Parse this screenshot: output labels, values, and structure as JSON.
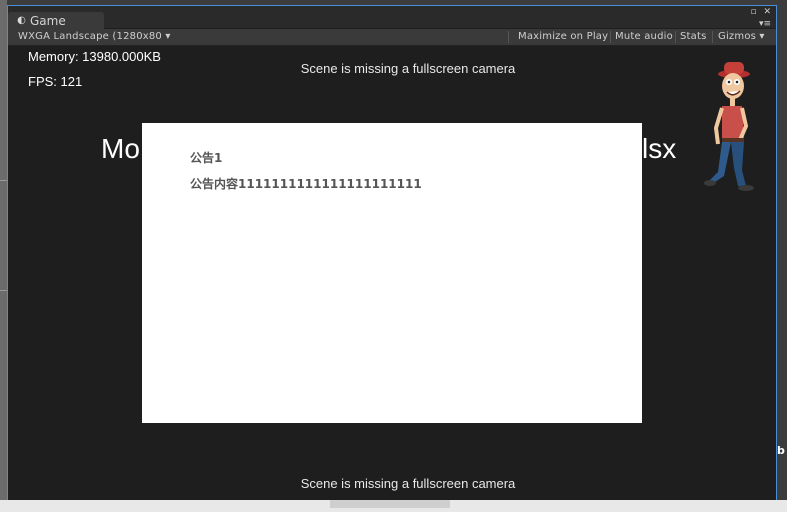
{
  "tab": {
    "label": "Game"
  },
  "window_controls": {
    "restore": "▫",
    "close": "✕",
    "menu": "▾≡"
  },
  "toolbar": {
    "resolution": "WXGA Landscape (1280x80 ▾",
    "maximize_on_play": "Maximize on Play",
    "mute_audio": "Mute audio",
    "stats": "Stats",
    "gizmos": "Gizmos ▾"
  },
  "hud": {
    "memory": "Memory: 13980.000KB",
    "fps": "FPS: 121"
  },
  "scene": {
    "missing_camera_top": "Scene is missing a fullscreen camera",
    "missing_camera_bottom": "Scene is missing a fullscreen camera",
    "big_text_left": "Mo",
    "big_text_right": "xlsx"
  },
  "notice_dialog": {
    "title": "公告1",
    "content": "公告内容1111111111111111111111"
  },
  "edge": {
    "right_b": "b"
  },
  "icons": {
    "tab_icon": "unity-icon",
    "character": "cartoon-character-icon"
  }
}
